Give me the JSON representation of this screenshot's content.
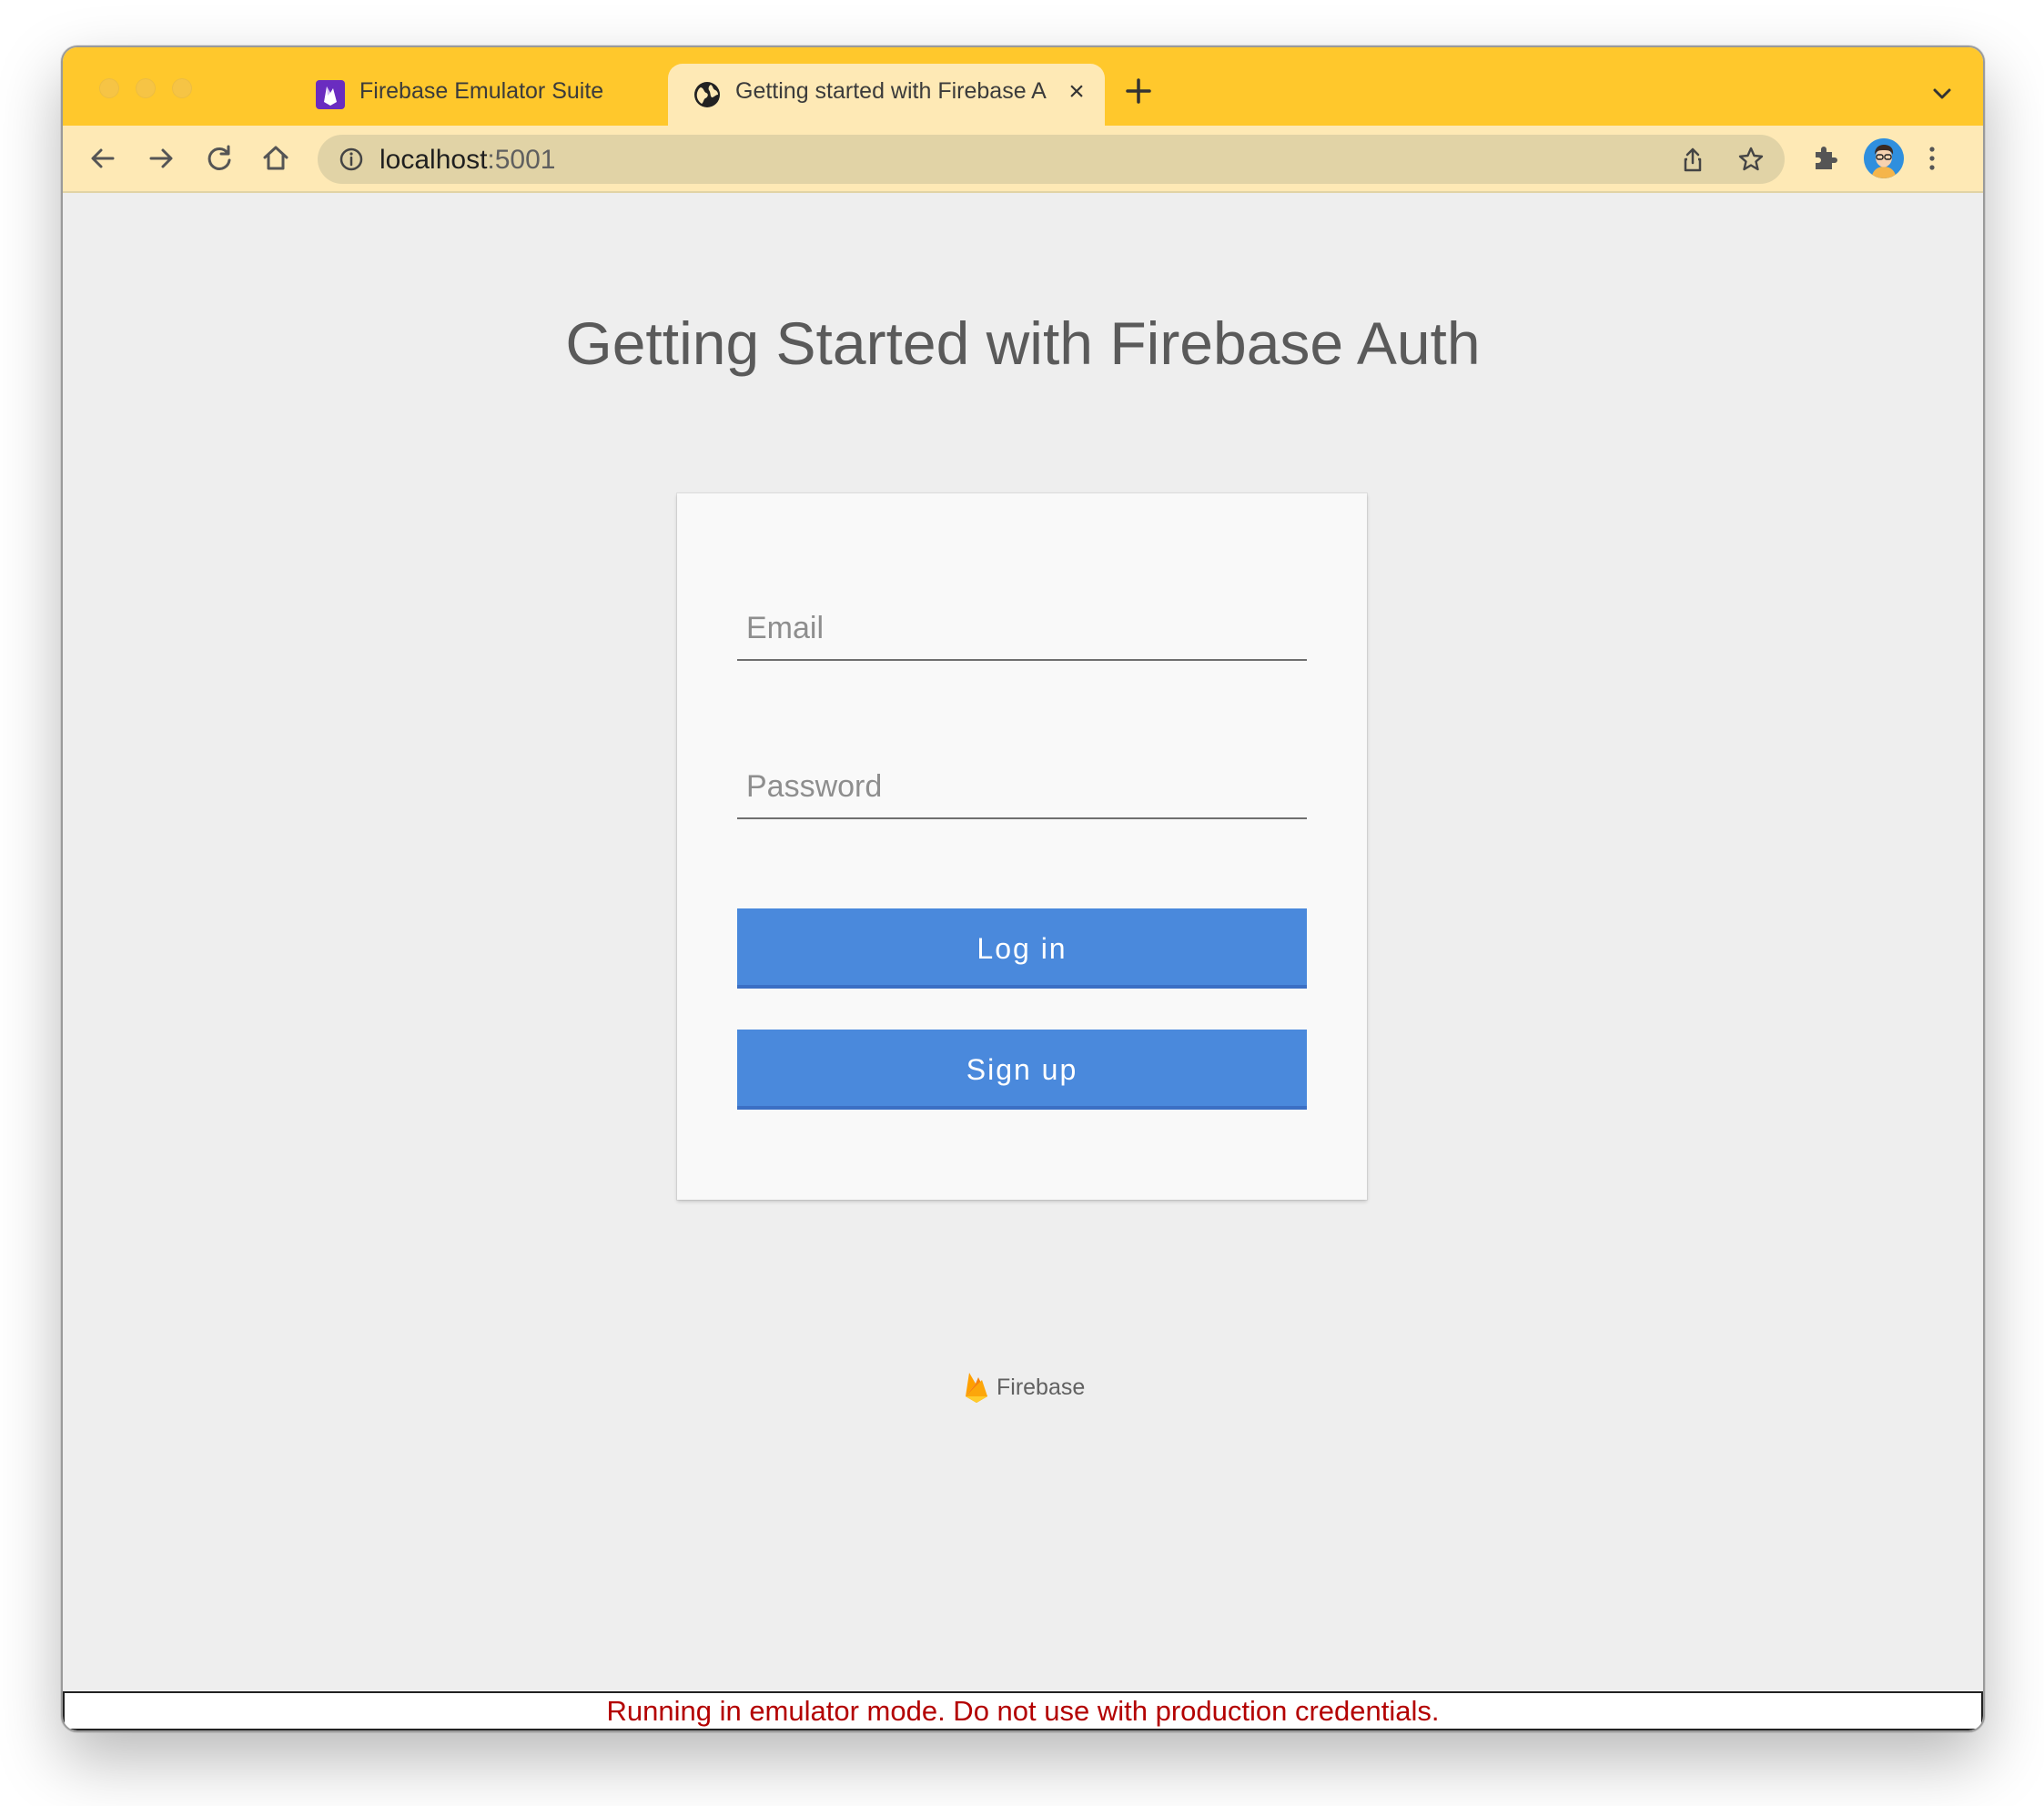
{
  "browser": {
    "tabs": [
      {
        "title": "Firebase Emulator Suite",
        "active": false,
        "favicon": "firebase-emulator-icon"
      },
      {
        "title": "Getting started with Firebase A",
        "active": true,
        "favicon": "globe-icon"
      }
    ],
    "address_bar": {
      "host": "localhost",
      "port": ":5001"
    },
    "colors": {
      "tabstrip": "#ffc82c",
      "toolbar": "#fee9b5",
      "omnibox": "#e1d3a6"
    }
  },
  "page": {
    "title": "Getting Started with Firebase Auth",
    "form": {
      "email_placeholder": "Email",
      "password_placeholder": "Password",
      "login_label": "Log in",
      "signup_label": "Sign up",
      "button_color": "#4a89dc"
    },
    "footer_logo_text": "Firebase",
    "emulator_banner": "Running in emulator mode. Do not use with production credentials."
  }
}
